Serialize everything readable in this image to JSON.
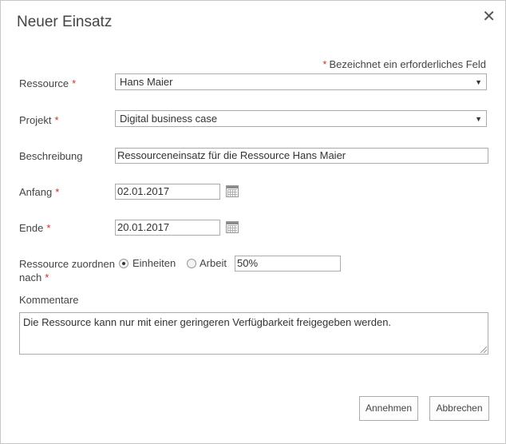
{
  "dialog": {
    "title": "Neuer Einsatz",
    "close_glyph": "✕"
  },
  "required_note": {
    "star": "*",
    "text": "Bezeichnet ein erforderliches Feld"
  },
  "form": {
    "ressource": {
      "label": "Ressource",
      "value": "Hans Maier"
    },
    "projekt": {
      "label": "Projekt",
      "value": "Digital business case"
    },
    "beschreibung": {
      "label": "Beschreibung",
      "value": "Ressourceneinsatz für die Ressource Hans Maier"
    },
    "anfang": {
      "label": "Anfang",
      "value": "02.01.2017"
    },
    "ende": {
      "label": "Ende",
      "value": "20.01.2017"
    },
    "zuordnen": {
      "label_line1": "Ressource zuordnen",
      "label_line2": "nach",
      "option_einheiten": "Einheiten",
      "option_arbeit": "Arbeit",
      "selected": "Einheiten",
      "value": "50%"
    },
    "kommentare": {
      "label": "Kommentare",
      "value": "Die Ressource kann nur mit einer geringeren Verfügbarkeit freigegeben werden."
    }
  },
  "star": "*",
  "dropdown_arrow": "▼",
  "buttons": {
    "accept": "Annehmen",
    "cancel": "Abbrechen"
  },
  "icons": {
    "close": "close-icon",
    "calendar": "calendar-icon",
    "dropdown": "chevron-down-icon"
  },
  "colors": {
    "required_star": "#c9302c",
    "border": "#ababab",
    "text": "#444444"
  }
}
